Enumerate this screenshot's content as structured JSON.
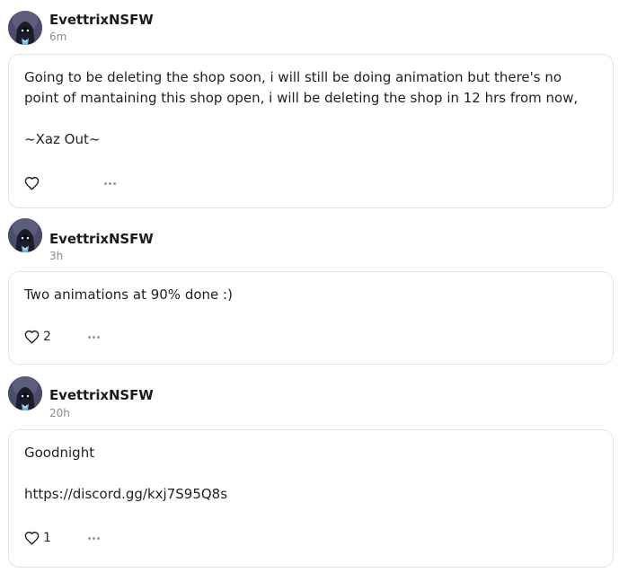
{
  "posts": [
    {
      "author": "EvettrixNSFW",
      "time": "6m",
      "paragraphs": [
        "Going to be deleting the shop soon, i will still be doing animation but there's no point of mantaining this shop open, i will be deleting the shop in 12 hrs from now,",
        "~Xaz Out~"
      ],
      "likes": ""
    },
    {
      "author": "EvettrixNSFW",
      "time": "3h",
      "paragraphs": [
        "Two animations at 90% done :)"
      ],
      "likes": "2"
    },
    {
      "author": "EvettrixNSFW",
      "time": "20h",
      "paragraphs": [
        "Goodnight",
        "https://discord.gg/kxj7S95Q8s"
      ],
      "likes": "1"
    }
  ],
  "icons": {
    "like": "heart-icon",
    "more": "more-options-icon",
    "avatar": "avatar-hooded-figure"
  },
  "colors": {
    "border": "#e4e4e4",
    "text": "#1f1f1f",
    "muted": "#8a8a8a",
    "avatar_bg": "#3a3f55",
    "avatar_glow": "#8fd3ff"
  }
}
